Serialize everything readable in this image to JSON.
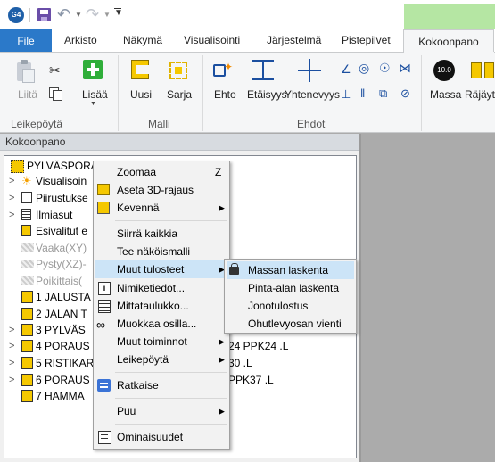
{
  "app_icon_label": "G4",
  "tabs": {
    "file": "File",
    "items": [
      "Arkisto",
      "Näkymä",
      "Visualisointi",
      "Järjestelmä",
      "Pistepilvet"
    ],
    "active": "Kokoonpano"
  },
  "ribbon": {
    "buttons": {
      "liita": "Liitä",
      "lisaa": "Lisää",
      "uusi": "Uusi",
      "sarja": "Sarja",
      "ehto": "Ehto",
      "etaisyys": "Etäisyys",
      "yhtenevyys": "Yhtenevyys",
      "massa": "Massa",
      "rajayt": "Räjäyt",
      "massa_icon_text": "10.0"
    },
    "groups": {
      "leikepoyta": "Leikepöytä",
      "malli": "Malli",
      "ehdot": "Ehdot"
    }
  },
  "panel": {
    "title": "Kokoonpano",
    "tree": [
      {
        "label": "PYLVÄSPORAU",
        "dim": false,
        "expander": "",
        "icon": "assembly-icon"
      },
      {
        "label": "Visualisoin",
        "dim": false,
        "expander": ">",
        "icon": "sun-icon"
      },
      {
        "label": "Piirustukse",
        "dim": false,
        "expander": ">",
        "icon": "drawing-icon"
      },
      {
        "label": "Ilmiasut",
        "dim": false,
        "expander": ">",
        "icon": "layers-icon"
      },
      {
        "label": "Esivalitut e",
        "dim": false,
        "expander": "",
        "icon": "preselect-icon"
      },
      {
        "label": "Vaaka(XY)",
        "dim": true,
        "expander": "",
        "icon": "plane-icon"
      },
      {
        "label": "Pysty(XZ)-",
        "dim": true,
        "expander": "",
        "icon": "plane-icon"
      },
      {
        "label": "Poikittais(",
        "dim": true,
        "expander": "",
        "icon": "plane-icon"
      },
      {
        "label": "1 JALUSTA",
        "dim": false,
        "expander": "",
        "icon": "part-icon"
      },
      {
        "label": "2 JALAN T",
        "dim": false,
        "expander": "",
        "icon": "part-icon"
      },
      {
        "label": "3 PYLVÄS",
        "dim": false,
        "expander": ">",
        "icon": "part-icon"
      },
      {
        "label": "4 PORAUS",
        "dim": false,
        "expander": ">",
        "icon": "part-icon"
      },
      {
        "label": "5 RISTIKAR",
        "dim": false,
        "expander": ">",
        "icon": "part-icon"
      },
      {
        "label": "6 PORAUS",
        "dim": false,
        "expander": ">",
        "icon": "part-icon"
      },
      {
        "label": "7 HAMMA",
        "dim": false,
        "expander": "",
        "icon": "part-icon"
      }
    ],
    "tree_suffixes": {
      "row4": "24 PPK24 .L",
      "row5": "30 .L",
      "row6": "PPK37 .L"
    }
  },
  "context_menu": {
    "items": [
      {
        "label": "Zoomaa",
        "shortcut": "Z"
      },
      {
        "label": "Aseta 3D-rajaus"
      },
      {
        "label": "Kevennä"
      },
      {
        "label": "Siirrä kaikkia"
      },
      {
        "label": "Tee näköismalli"
      },
      {
        "label": "Muut tulosteet"
      },
      {
        "label": "Nimiketiedot..."
      },
      {
        "label": "Mittataulukko..."
      },
      {
        "label": "Muokkaa osilla..."
      },
      {
        "label": "Muut toiminnot"
      },
      {
        "label": "Leikepöytä"
      },
      {
        "label": "Ratkaise"
      },
      {
        "label": "Puu"
      },
      {
        "label": "Ominaisuudet"
      }
    ]
  },
  "submenu": {
    "items": [
      {
        "label": "Massan laskenta"
      },
      {
        "label": "Pinta-alan laskenta"
      },
      {
        "label": "Jonotulostus"
      },
      {
        "label": "Ohutlevyosan vienti"
      }
    ]
  },
  "colors": {
    "file_tab": "#2b79c9",
    "context_tab_strip": "#b5e6a3",
    "menu_highlight": "#cce4f7",
    "part_icon": "#f5c800"
  }
}
